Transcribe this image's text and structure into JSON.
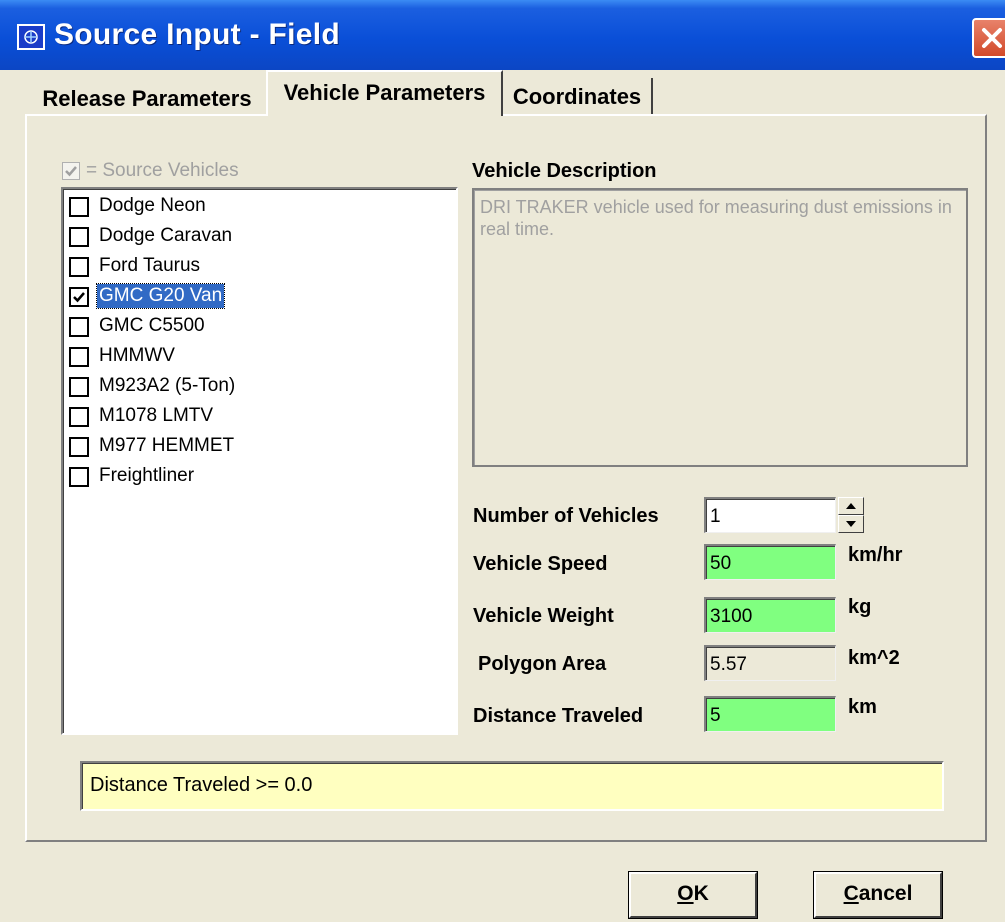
{
  "window": {
    "title": "Source Input - Field",
    "icon": "app-icon",
    "close_icon": "close-icon"
  },
  "tabs": [
    {
      "label": "Release Parameters",
      "active": false
    },
    {
      "label": "Vehicle Parameters",
      "active": true
    },
    {
      "label": "Coordinates",
      "active": false
    }
  ],
  "legend": {
    "checked": true,
    "label": "= Source Vehicles"
  },
  "vehicles": [
    {
      "label": "Dodge Neon",
      "checked": false,
      "selected": false
    },
    {
      "label": "Dodge Caravan",
      "checked": false,
      "selected": false
    },
    {
      "label": "Ford Taurus",
      "checked": false,
      "selected": false
    },
    {
      "label": "GMC G20 Van",
      "checked": true,
      "selected": true
    },
    {
      "label": "GMC C5500",
      "checked": false,
      "selected": false
    },
    {
      "label": "HMMWV",
      "checked": false,
      "selected": false
    },
    {
      "label": "M923A2 (5-Ton)",
      "checked": false,
      "selected": false
    },
    {
      "label": "M1078 LMTV",
      "checked": false,
      "selected": false
    },
    {
      "label": "M977 HEMMET",
      "checked": false,
      "selected": false
    },
    {
      "label": "Freightliner",
      "checked": false,
      "selected": false
    }
  ],
  "description": {
    "heading": "Vehicle Description",
    "text": "DRI TRAKER vehicle used for measuring dust emissions in real time."
  },
  "params": {
    "num_vehicles": {
      "label": "Number of Vehicles",
      "value": "1"
    },
    "speed": {
      "label": "Vehicle Speed",
      "value": "50",
      "unit": "km/hr"
    },
    "weight": {
      "label": "Vehicle Weight",
      "value": "3100",
      "unit": "kg"
    },
    "area": {
      "label": "Polygon Area",
      "value": "5.57",
      "unit": "km^2"
    },
    "distance": {
      "label": "Distance Traveled",
      "value": "5",
      "unit": "km"
    }
  },
  "status": {
    "message": "Distance Traveled >= 0.0"
  },
  "buttons": {
    "ok": {
      "label": "OK",
      "underline": "O",
      "rest": "K"
    },
    "cancel": {
      "label": "Cancel",
      "underline": "C",
      "rest": "ancel"
    }
  },
  "colors": {
    "titlebar": "#0a4fd8",
    "field_valid": "#80ff80",
    "status_bg": "#ffffc0",
    "selection": "#316ac5",
    "dialog_bg": "#ece9d8"
  }
}
